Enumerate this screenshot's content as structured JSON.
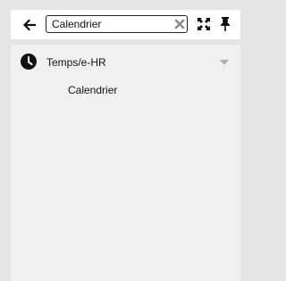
{
  "toolbar": {
    "back_icon": "arrow-left-icon",
    "search": {
      "value": "Calendrier"
    },
    "clear_icon": "close-x-icon",
    "expand_icon": "expand-arrows-icon",
    "pin_icon": "pushpin-icon"
  },
  "menu": {
    "groups": [
      {
        "label": "Temps/e-HR",
        "icon": "clock-icon",
        "expanded": true,
        "items": [
          {
            "label": "Calendrier"
          }
        ]
      }
    ]
  },
  "colors": {
    "background": "#e5e5e5",
    "toolbar_bg": "#ffffff",
    "panel_bg": "#f0f0f0",
    "icon_dark": "#111111",
    "icon_grey": "#8a8a8a"
  }
}
